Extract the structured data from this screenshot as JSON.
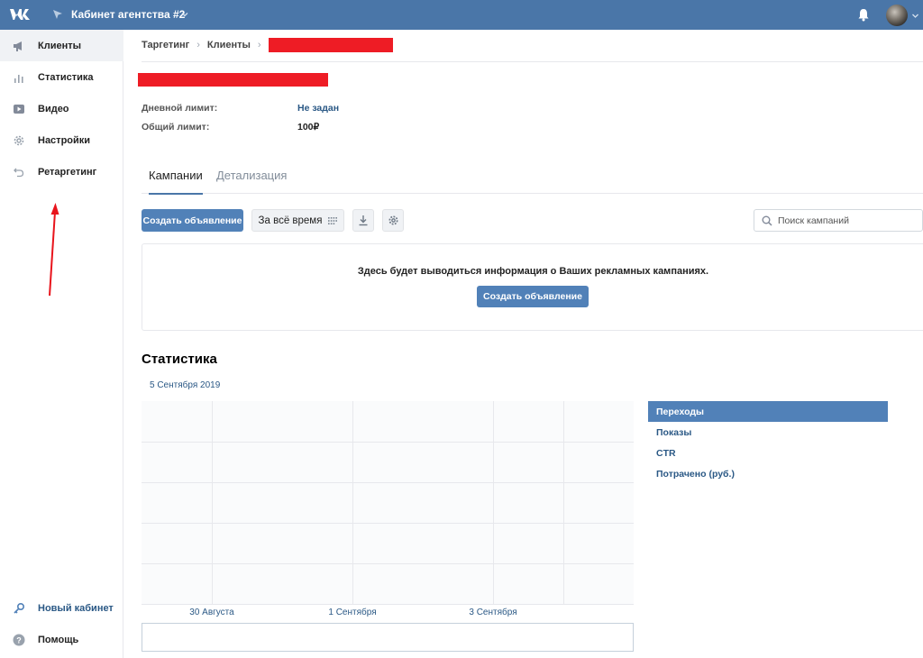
{
  "topbar": {
    "cabinet_title": "Кабинет агентства #2",
    "brand_color": "#4a76a8"
  },
  "sidebar": {
    "items": [
      {
        "label": "Клиенты",
        "icon": "megaphone-icon",
        "active": true
      },
      {
        "label": "Статистика",
        "icon": "bar-chart-icon"
      },
      {
        "label": "Видео",
        "icon": "video-icon"
      },
      {
        "label": "Настройки",
        "icon": "gear-icon"
      },
      {
        "label": "Ретаргетинг",
        "icon": "undo-arrow-icon"
      }
    ],
    "bottom_items": [
      {
        "label": "Новый кабинет",
        "icon": "key-icon"
      },
      {
        "label": "Помощь",
        "icon": "help-icon"
      }
    ]
  },
  "breadcrumb": {
    "items": [
      "Таргетинг",
      "Клиенты"
    ]
  },
  "limits": {
    "daily_label": "Дневной лимит:",
    "daily_value": "Не задан",
    "total_label": "Общий лимит:",
    "total_value": "100₽"
  },
  "tabs": [
    "Кампании",
    "Детализация"
  ],
  "toolbar": {
    "create_label": "Создать объявление",
    "period_label": "За всё время",
    "search_placeholder": "Поиск кампаний"
  },
  "empty_state": {
    "message": "Здесь будет выводиться информация о Ваших рекламных кампаниях.",
    "create_label": "Создать объявление"
  },
  "stats": {
    "title": "Статистика",
    "date": "5 Сентября 2019"
  },
  "chart_data": {
    "type": "line",
    "x_tick_labels": [
      "30 Августа",
      "1 Сентября",
      "3 Сентября"
    ],
    "series": [],
    "grid": true
  },
  "legend": [
    "Переходы",
    "Показы",
    "CTR",
    "Потрачено (руб.)"
  ]
}
